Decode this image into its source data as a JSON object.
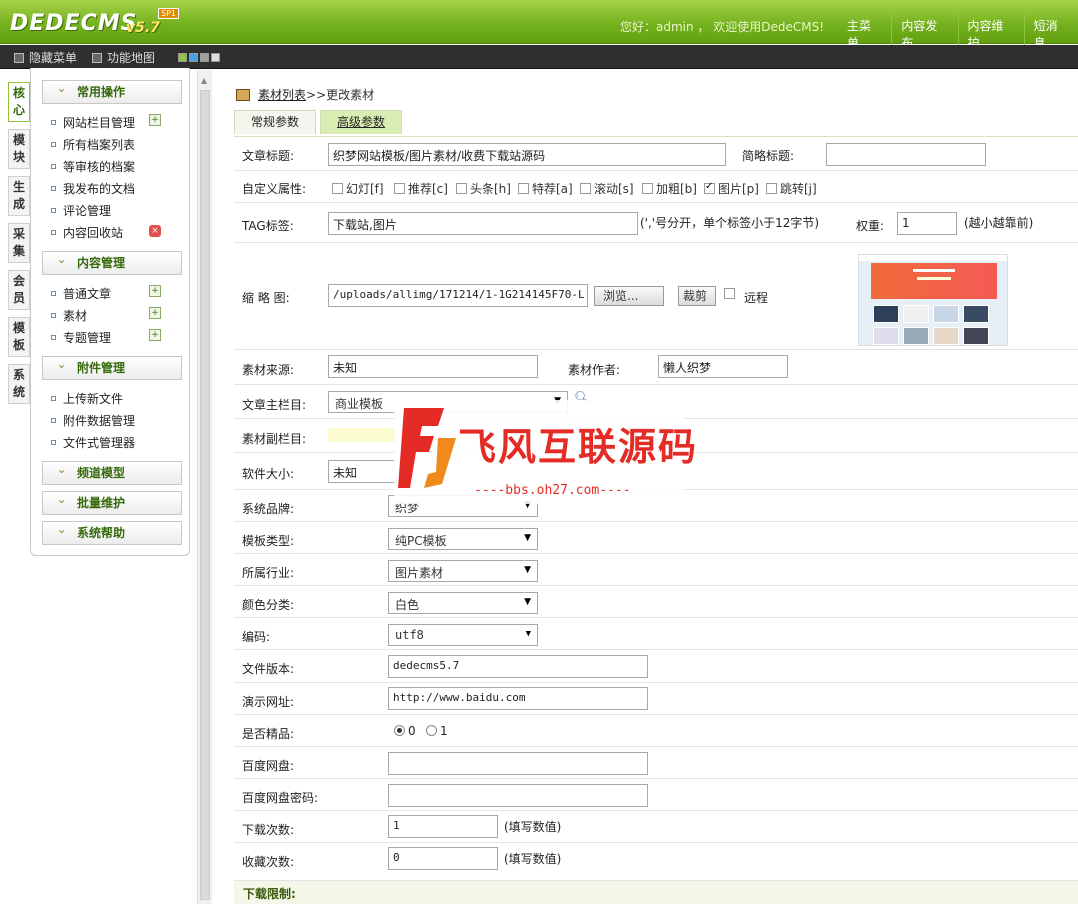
{
  "header": {
    "logo": "DEDECMS",
    "version": "v5.7",
    "edition": "SP1",
    "welcome": "您好：admin ， 欢迎使用DedeCMS!",
    "nav": [
      "主菜单",
      "内容发布",
      "内容维护",
      "短消息"
    ]
  },
  "toolbar": {
    "hide_menu": "隐藏菜单",
    "site_map": "功能地图",
    "skin_colors": [
      "#8fc63a",
      "#4aa0e0",
      "#a0a0a0",
      "#dddddd"
    ]
  },
  "side_tabs": [
    "核心",
    "模块",
    "生成",
    "采集",
    "会员",
    "模板",
    "系统"
  ],
  "menu": {
    "groups": [
      {
        "title": "常用操作",
        "items": [
          "网站栏目管理",
          "所有档案列表",
          "等审核的档案",
          "我发布的文档",
          "评论管理",
          "内容回收站"
        ]
      },
      {
        "title": "内容管理",
        "items": [
          "普通文章",
          "素材",
          "专题管理"
        ]
      },
      {
        "title": "附件管理",
        "items": [
          "上传新文件",
          "附件数据管理",
          "文件式管理器"
        ]
      },
      {
        "title": "频道模型",
        "items": []
      },
      {
        "title": "批量维护",
        "items": []
      },
      {
        "title": "系统帮助",
        "items": []
      }
    ]
  },
  "breadcrumb": {
    "link": "素材列表",
    "sep": ">>",
    "current": "更改素材"
  },
  "tabs": [
    "常规参数",
    "高级参数"
  ],
  "form": {
    "title_label": "文章标题:",
    "title_value": "织梦网站模板/图片素材/收费下载站源码",
    "short_title_label": "简略标题:",
    "short_title_value": "",
    "flags_label": "自定义属性:",
    "flags": [
      {
        "label": "幻灯[f]",
        "checked": false
      },
      {
        "label": "推荐[c]",
        "checked": false
      },
      {
        "label": "头条[h]",
        "checked": false
      },
      {
        "label": "特荐[a]",
        "checked": false
      },
      {
        "label": "滚动[s]",
        "checked": false
      },
      {
        "label": "加粗[b]",
        "checked": false
      },
      {
        "label": "图片[p]",
        "checked": true
      },
      {
        "label": "跳转[j]",
        "checked": false
      }
    ],
    "tag_label": "TAG标签:",
    "tag_value": "下载站,图片",
    "tag_hint": "(','号分开，单个标签小于12字节)",
    "weight_label": "权重:",
    "weight_value": "1",
    "weight_hint": "(越小越靠前)",
    "thumb_label": "缩 略 图:",
    "thumb_value": "/uploads/allimg/171214/1-1G214145F70-L.jpg",
    "browse_btn": "浏览...",
    "crop_btn": "裁剪",
    "remote_label": "远程",
    "source_label": "素材来源:",
    "source_value": "未知",
    "author_label": "素材作者:",
    "author_value": "懒人织梦",
    "main_col_label": "文章主栏目:",
    "main_col_value": "商业模板",
    "sub_col_label": "素材副栏目:",
    "size_label": "软件大小:",
    "size_value": "未知",
    "brand_label": "系统品牌:",
    "brand_value": "织梦",
    "tpl_type_label": "模板类型:",
    "tpl_type_value": "纯PC模板",
    "industry_label": "所属行业:",
    "industry_value": "图片素材",
    "color_label": "颜色分类:",
    "color_value": "白色",
    "encoding_label": "编码:",
    "encoding_value": "utf8",
    "file_ver_label": "文件版本:",
    "file_ver_value": "dedecms5.7",
    "demo_label": "演示网址:",
    "demo_value": "http://www.baidu.com",
    "best_label": "是否精品:",
    "best_options": [
      "0",
      "1"
    ],
    "best_selected": "0",
    "pan_label": "百度网盘:",
    "pan_value": "",
    "pan_pwd_label": "百度网盘密码:",
    "pan_pwd_value": "",
    "downloads_label": "下载次数:",
    "downloads_value": "1",
    "downloads_hint": "(填写数值)",
    "favs_label": "收藏次数:",
    "favs_value": "0",
    "favs_hint": "(填写数值)",
    "dl_limit_label": "下载限制:"
  },
  "watermark": {
    "text": "飞风互联源码",
    "url": "----bbs.oh27.com----"
  }
}
